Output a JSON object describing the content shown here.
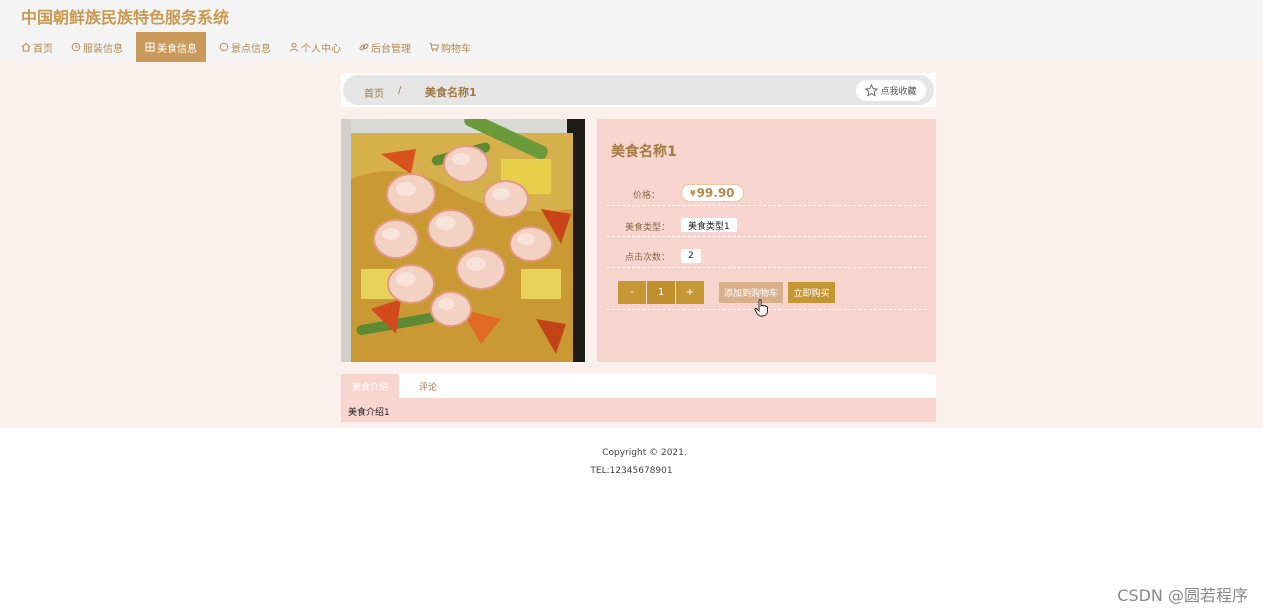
{
  "site": {
    "title": "中国朝鲜族民族特色服务系统"
  },
  "nav": {
    "items": [
      {
        "label": "首页",
        "icon": "home-icon"
      },
      {
        "label": "服装信息",
        "icon": "clock-icon"
      },
      {
        "label": "美食信息",
        "icon": "grid-icon",
        "active": true
      },
      {
        "label": "景点信息",
        "icon": "circle-icon"
      },
      {
        "label": "个人中心",
        "icon": "user-icon"
      },
      {
        "label": "后台管理",
        "icon": "link-icon"
      },
      {
        "label": "购物车",
        "icon": "cart-icon"
      }
    ]
  },
  "breadcrumb": {
    "home": "首页",
    "separator": "/",
    "current": "美食名称1"
  },
  "favorite": {
    "label": "点我收藏",
    "icon": "star-icon"
  },
  "detail": {
    "title": "美食名称1",
    "price_label": "价格：",
    "currency": "¥",
    "price": "99.90",
    "type_label": "美食类型：",
    "type_value": "美食类型1",
    "clicks_label": "点击次数：",
    "clicks_value": "2",
    "qty_minus": "-",
    "qty_value": "1",
    "qty_plus": "+",
    "add_cart": "添加到购物车",
    "buy_now": "立即购买"
  },
  "tabs": {
    "intro": "美食介绍",
    "comments": "评论",
    "intro_content": "美食介绍1"
  },
  "footer": {
    "copyright": "Copyright © 2021.",
    "tel": "TEL:12345678901"
  },
  "watermark": "CSDN @圆若程序",
  "colors": {
    "accent": "#c99a5a",
    "accent_dark": "#c59634",
    "panel": "#f9d5cf",
    "page_bg": "#fcf0ed"
  }
}
